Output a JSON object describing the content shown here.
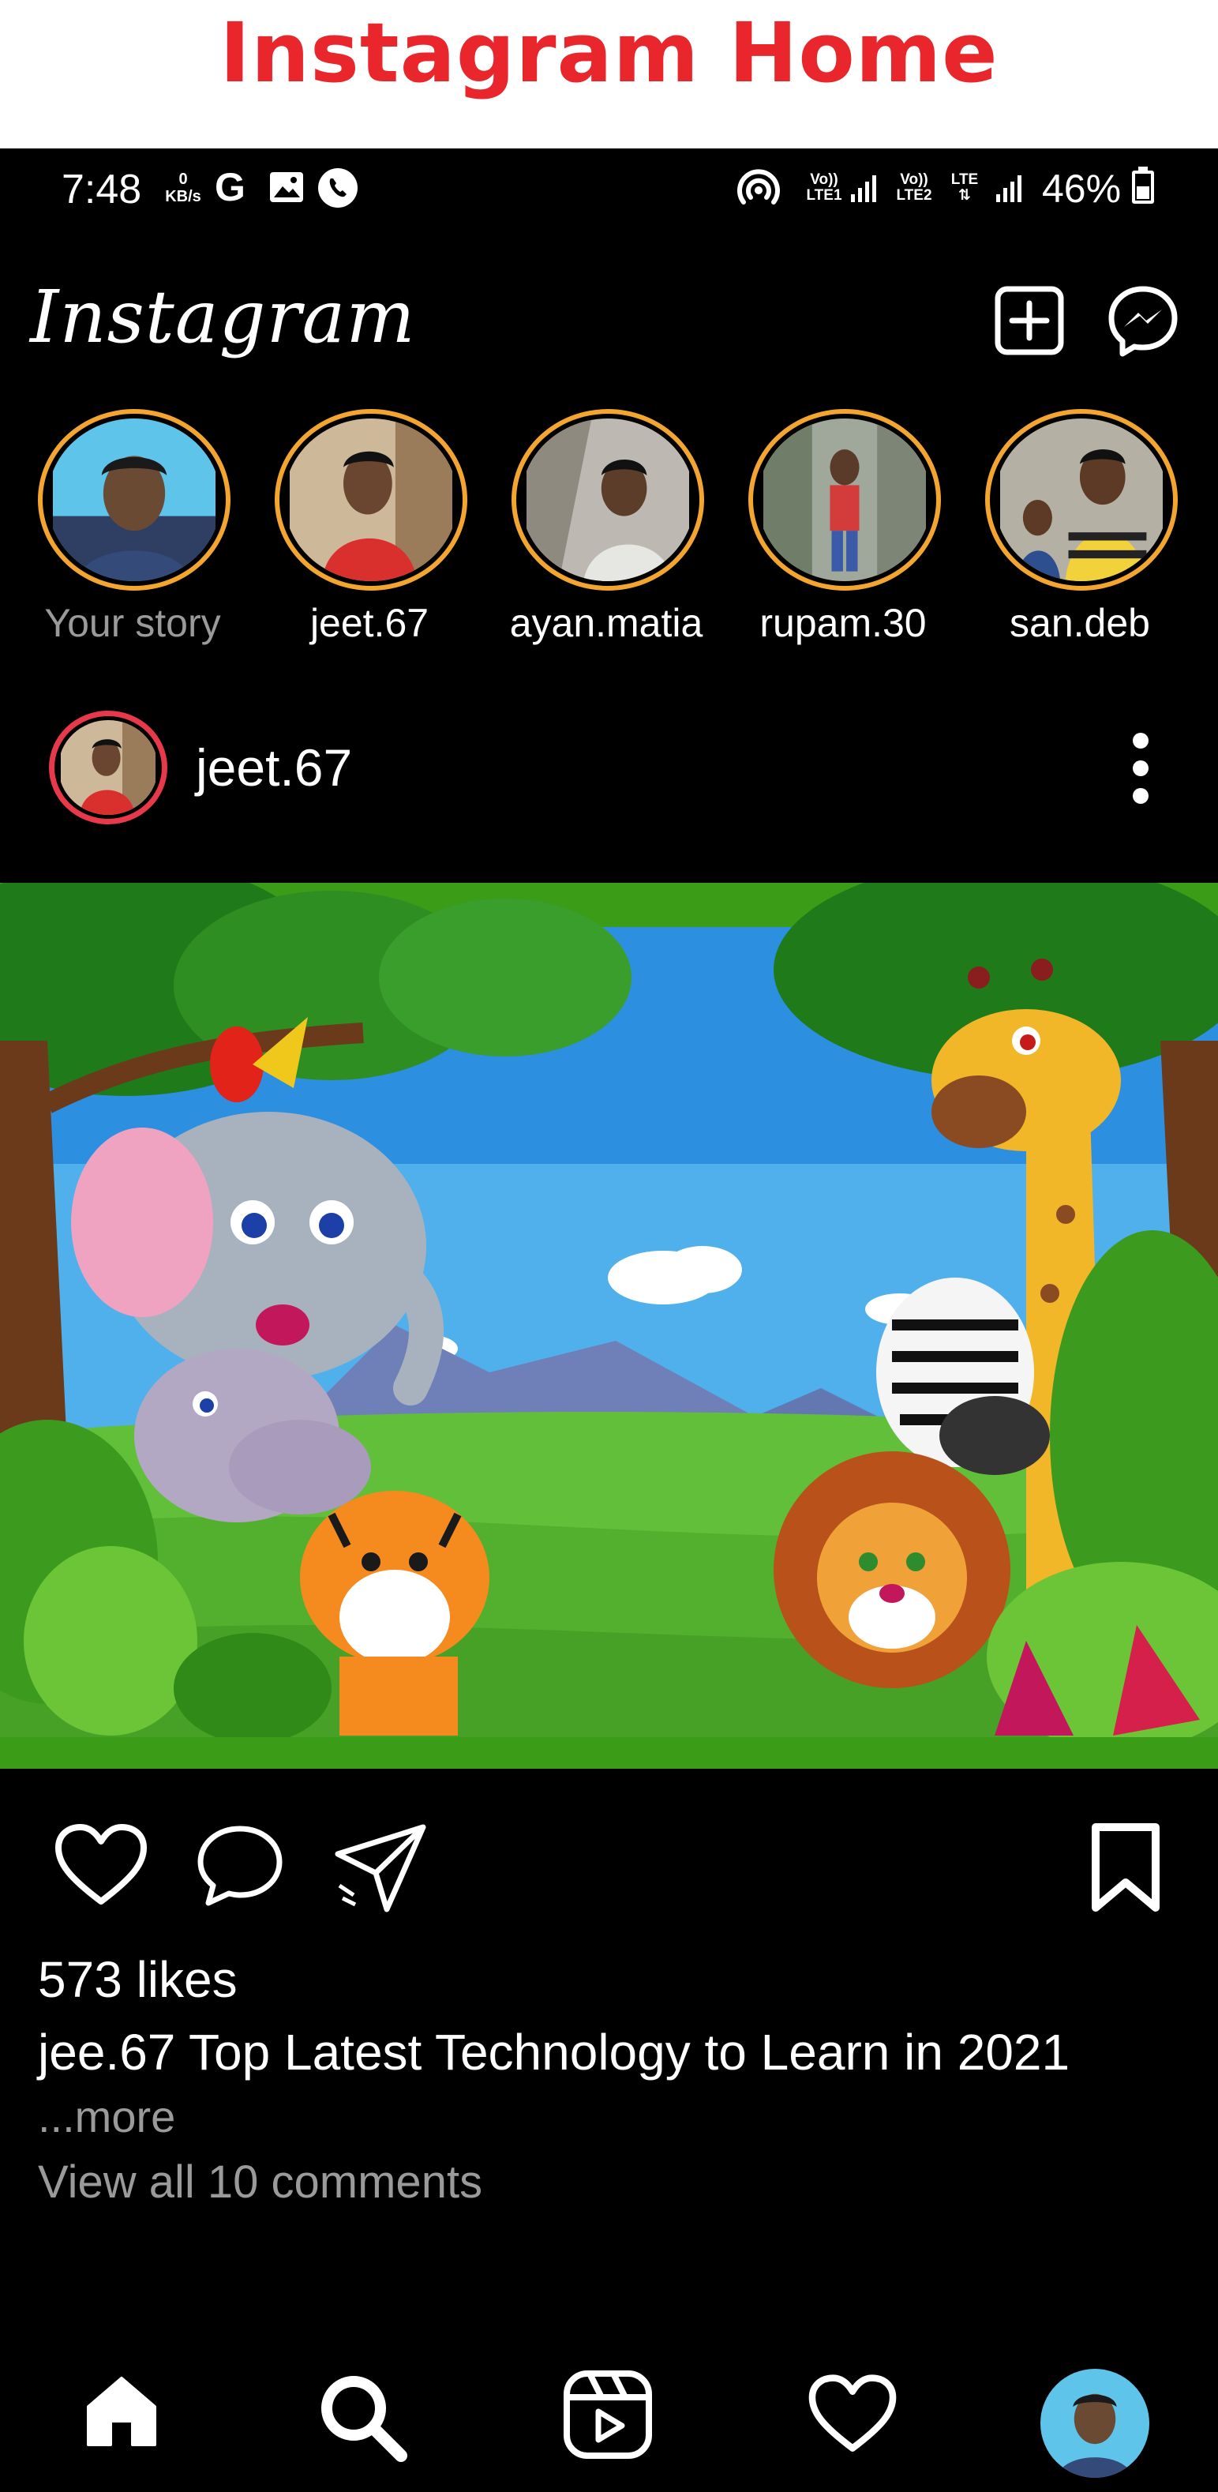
{
  "banner": {
    "title": "Instagram Home"
  },
  "status_bar": {
    "time": "7:48",
    "data_rate_value": "0",
    "data_rate_unit": "KB/s",
    "carrier_glyph": "G",
    "sim1_label": "Vo))",
    "sim1_sub": "LTE1",
    "sim2_label": "Vo))",
    "sim2_sub": "LTE2",
    "lte_label": "LTE",
    "battery": "46%",
    "battery_level": 0.46,
    "icons": [
      "gallery-icon",
      "phone-call-icon",
      "hotspot-icon",
      "signal-icon",
      "battery-charging-icon"
    ]
  },
  "header": {
    "logo": "Instagram",
    "icons": [
      "new-post-icon",
      "messenger-icon"
    ]
  },
  "stories": [
    {
      "label": "Your story",
      "own": true
    },
    {
      "label": "jeet.67",
      "own": false
    },
    {
      "label": "ayan.matia",
      "own": false
    },
    {
      "label": "rupam.30",
      "own": false
    },
    {
      "label": "san.deb",
      "own": false
    }
  ],
  "post": {
    "username": "jeet.67",
    "likes": "573 likes",
    "caption": "jee.67 Top Latest Technology to Learn in 2021",
    "more": "...more",
    "comments": "View all 10 comments",
    "icons": [
      "like-heart-icon",
      "comment-icon",
      "share-icon",
      "bookmark-icon",
      "more-options-icon"
    ]
  },
  "bottom_nav": {
    "items": [
      "home-icon",
      "search-icon",
      "reels-icon",
      "activity-heart-icon",
      "profile-avatar"
    ]
  },
  "colors": {
    "banner_title": "#e8262b",
    "story_ring": "#f3a530",
    "post_avatar_ring": "#e8394b",
    "muted_text": "#9a9a9a",
    "background": "#000000"
  }
}
